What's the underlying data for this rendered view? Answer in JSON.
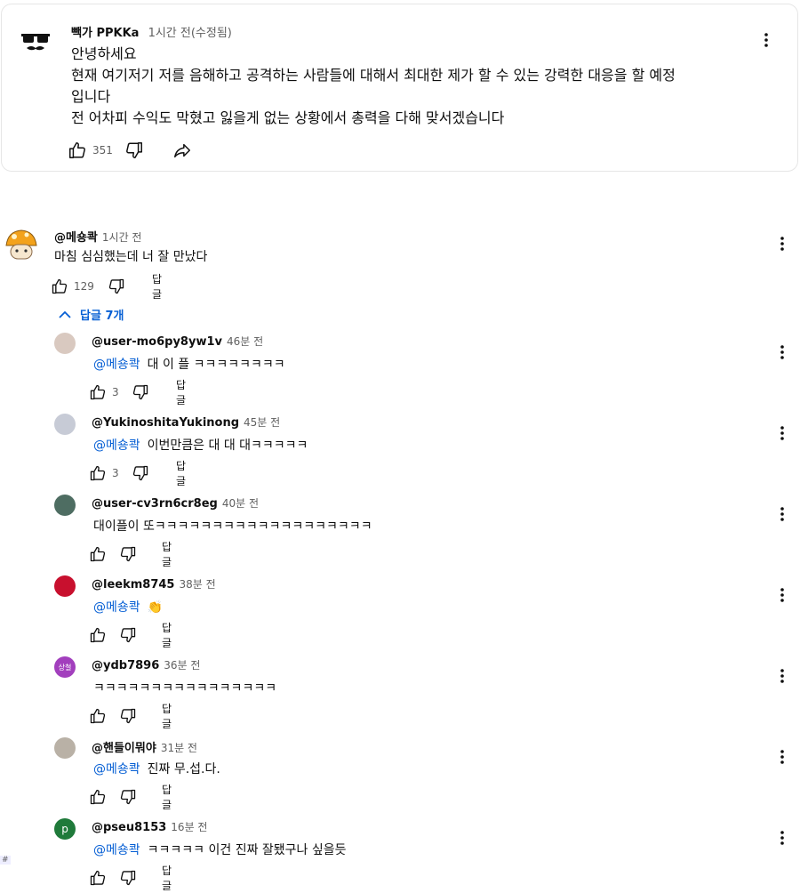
{
  "post": {
    "author": "빽가 PPKKa",
    "time": "1시간 전(수정됨)",
    "lines": [
      "안녕하세요",
      "현재 여기저기 저를 음해하고 공격하는 사람들에 대해서 최대한 제가 할 수 있는 강력한 대응을 할 예정",
      "입니다",
      "전 어차피 수익도 막혔고  잃을게 없는 상황에서 총력을 다해 맞서겠습니다"
    ],
    "likes": "351"
  },
  "comment": {
    "author": "@메숑콱",
    "time": "1시간 전",
    "text": "마침 심심했는데 너 잘 만났다",
    "likes": "129",
    "reply_label": "답글",
    "replies_toggle": "답글 7개"
  },
  "replies": [
    {
      "author": "@user-mo6py8yw1v",
      "time": "46분 전",
      "mention": "@메숑콱",
      "text": "대 이 플 ㅋㅋㅋㅋㅋㅋㅋㅋ",
      "likes": "3",
      "reply_label": "답글",
      "avatar_color": "#d9c9c0"
    },
    {
      "author": "@YukinoshitaYukinong",
      "time": "45분 전",
      "mention": "@메숑콱",
      "text": "이번만큼은 대 대 대ㅋㅋㅋㅋㅋ",
      "likes": "3",
      "reply_label": "답글",
      "avatar_color": "#c7cbd6"
    },
    {
      "author": "@user-cv3rn6cr8eg",
      "time": "40분 전",
      "mention": "",
      "text": "대이플이 또ㅋㅋㅋㅋㅋㅋㅋㅋㅋㅋㅋㅋㅋㅋㅋㅋㅋㅋㅋ",
      "likes": "",
      "reply_label": "답글",
      "avatar_color": "#4e6d62"
    },
    {
      "author": "@leekm8745",
      "time": "38분 전",
      "mention": "@메숑콱",
      "text": "👏",
      "likes": "",
      "reply_label": "답글",
      "avatar_color": "#c8102e"
    },
    {
      "author": "@ydb7896",
      "time": "36분 전",
      "mention": "",
      "text": "ㅋㅋㅋㅋㅋㅋㅋㅋㅋㅋㅋㅋㅋㅋㅋㅋ",
      "likes": "",
      "reply_label": "답글",
      "avatar_color": "#a23fbd",
      "avatar_text": "상철"
    },
    {
      "author": "@핸들이뭐야",
      "time": "31분 전",
      "mention": "@메숑콱",
      "text": "진짜 무.섭.다.",
      "likes": "",
      "reply_label": "답글",
      "avatar_color": "#b9b1a6"
    },
    {
      "author": "@pseu8153",
      "time": "16분 전",
      "mention": "@메숑콱",
      "text": "ㅋㅋㅋㅋㅋ 이건 진짜 잘됐구나 싶을듯",
      "likes": "",
      "reply_label": "답글",
      "avatar_color": "#1f7a3a",
      "avatar_text": "p"
    }
  ],
  "corner_mark": "#",
  "icons": {
    "like": "thumbs-up-icon",
    "dislike": "thumbs-down-icon",
    "share": "share-icon",
    "more": "more-vertical-icon",
    "chevron": "chevron-up-icon"
  },
  "colors": {
    "link": "#065fd4",
    "muted": "#606060"
  }
}
